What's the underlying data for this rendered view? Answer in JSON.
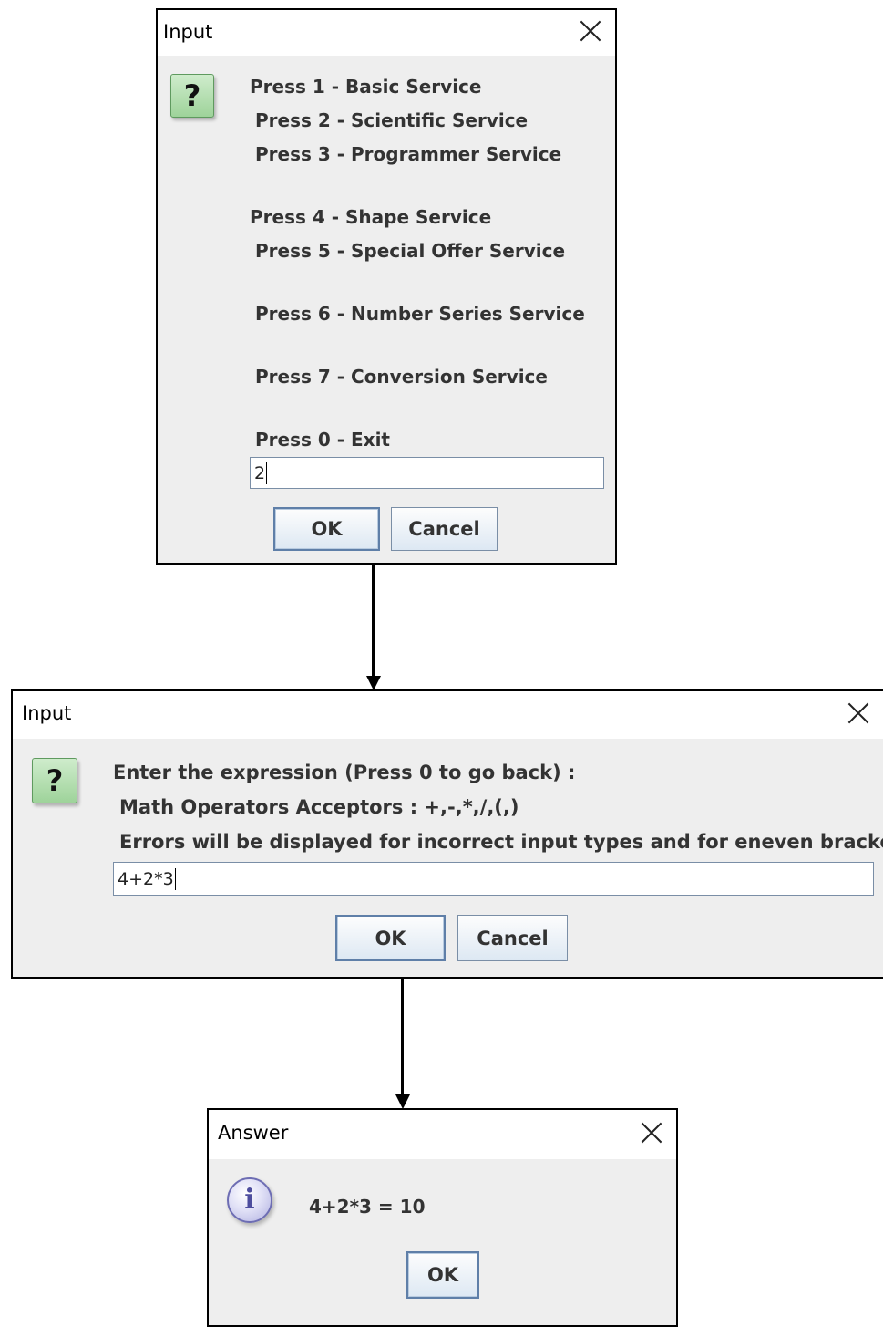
{
  "dialog1": {
    "title": "Input",
    "lines": [
      "Press 1 - Basic Service",
      "Press 2 - Scientific Service",
      "Press 3 - Programmer Service",
      "Press 4 - Shape Service",
      "Press 5 - Special Offer Service",
      "Press 6 - Number Series Service",
      "Press 7 - Conversion Service",
      "Press 0 - Exit"
    ],
    "input_value": "2",
    "ok_label": "OK",
    "cancel_label": "Cancel",
    "icon": "question-icon"
  },
  "dialog2": {
    "title": "Input",
    "lines": [
      "Enter the expression (Press 0 to go back) :",
      "Math Operators Acceptors : +,-,*,/,(,)",
      "Errors will be displayed for incorrect input types and for eneven brackets"
    ],
    "input_value": "4+2*3",
    "ok_label": "OK",
    "cancel_label": "Cancel",
    "icon": "question-icon"
  },
  "dialog3": {
    "title": "Answer",
    "message": "4+2*3 = 10",
    "ok_label": "OK",
    "icon": "info-icon"
  },
  "icon_glyphs": {
    "question": "?",
    "info": "i"
  },
  "colors": {
    "dialog_bg": "#eeeeee",
    "titlebar_bg": "#ffffff",
    "border": "#000000"
  }
}
